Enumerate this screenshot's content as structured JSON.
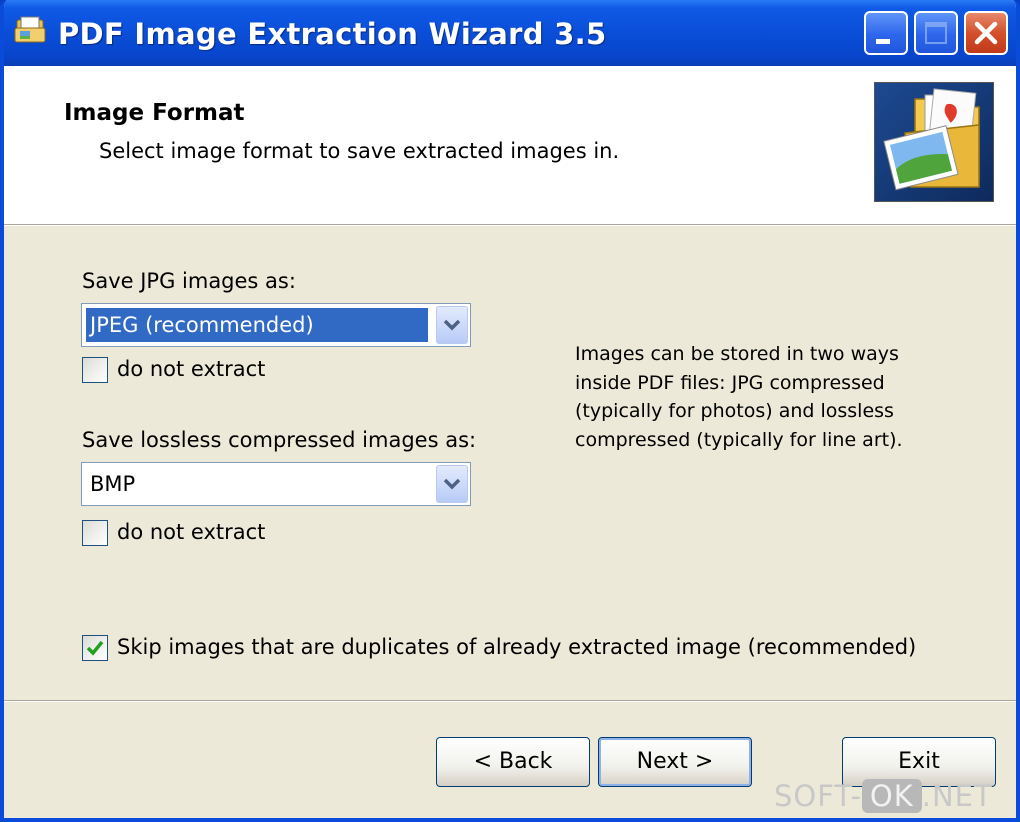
{
  "window": {
    "title": "PDF Image Extraction Wizard 3.5",
    "controls": [
      "minimize",
      "maximize",
      "close"
    ]
  },
  "header": {
    "title": "Image Format",
    "subtitle": "Select image format to save extracted images in."
  },
  "form": {
    "jpg_label": "Save JPG images as:",
    "jpg_format": "JPEG (recommended)",
    "jpg_do_not_extract": "do not extract",
    "jpg_do_not_extract_checked": false,
    "lossless_label": "Save lossless compressed images as:",
    "lossless_format": "BMP",
    "lossless_do_not_extract": "do not extract",
    "lossless_do_not_extract_checked": false,
    "skip_duplicates": "Skip images that are duplicates of already extracted image (recommended)",
    "skip_duplicates_checked": true
  },
  "info": {
    "text": "Images can be stored in two ways inside PDF files: JPG compressed (typically for photos) and lossless compressed (typically for line art)."
  },
  "buttons": {
    "back": "< Back",
    "next": "Next >",
    "exit": "Exit"
  },
  "watermark": {
    "left": "SOFT-",
    "middle": "OK",
    "right": ".NET"
  },
  "colors": {
    "title_bar": "#0a4ed8",
    "selection": "#316ac5",
    "dialog_bg": "#ece9d8",
    "close_button": "#d4502b"
  }
}
